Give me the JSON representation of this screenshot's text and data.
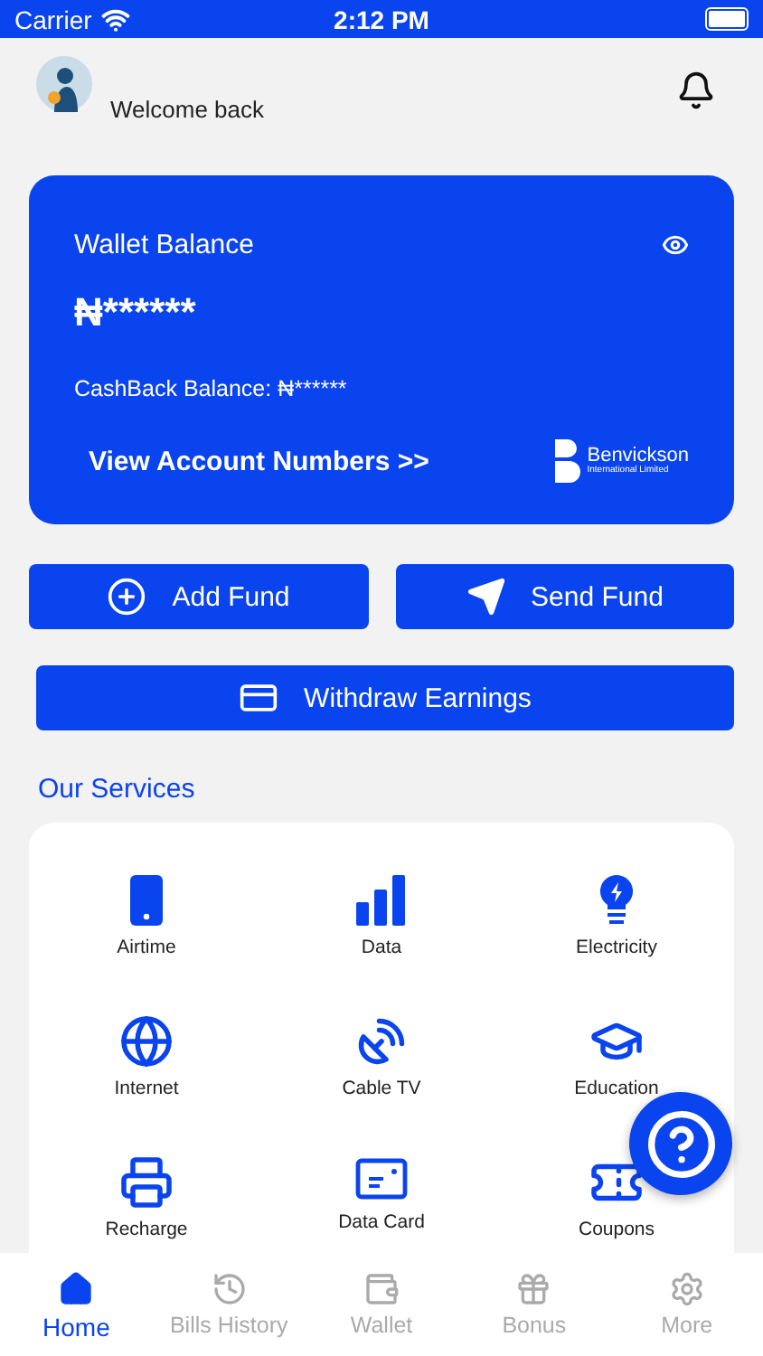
{
  "status_bar": {
    "carrier": "Carrier",
    "time": "2:12 PM"
  },
  "header": {
    "greeting": "Welcome back"
  },
  "wallet_card": {
    "title": "Wallet Balance",
    "balance": "₦******",
    "cashback_label": "CashBack Balance:",
    "cashback_value": "₦******",
    "link": "View Account Numbers >>",
    "logo_name": "Benvickson",
    "logo_sub": "International Limited"
  },
  "actions": [
    {
      "label": "Add Fund",
      "kind": "add"
    },
    {
      "label": "Send Fund",
      "kind": "send"
    },
    {
      "label": "Withdraw Earnings",
      "kind": "withdraw"
    }
  ],
  "services_title": "Our Services",
  "services": [
    {
      "label": "Airtime",
      "kind": "phone"
    },
    {
      "label": "Data",
      "kind": "bars"
    },
    {
      "label": "Electricity",
      "kind": "bulb"
    },
    {
      "label": "Internet",
      "kind": "globe"
    },
    {
      "label": "Cable TV",
      "kind": "dish"
    },
    {
      "label": "Education",
      "kind": "cap"
    },
    {
      "label": "Recharge",
      "kind": "printer"
    },
    {
      "label": "Data Card",
      "kind": "card"
    },
    {
      "label": "Coupons",
      "kind": "ticket"
    }
  ],
  "tabs": [
    {
      "label": "Home",
      "kind": "home",
      "selected": true
    },
    {
      "label": "Bills History",
      "kind": "history",
      "selected": false
    },
    {
      "label": "Wallet",
      "kind": "wallet",
      "selected": false
    },
    {
      "label": "Bonus",
      "kind": "gift",
      "selected": false
    },
    {
      "label": "More",
      "kind": "more",
      "selected": false
    }
  ]
}
